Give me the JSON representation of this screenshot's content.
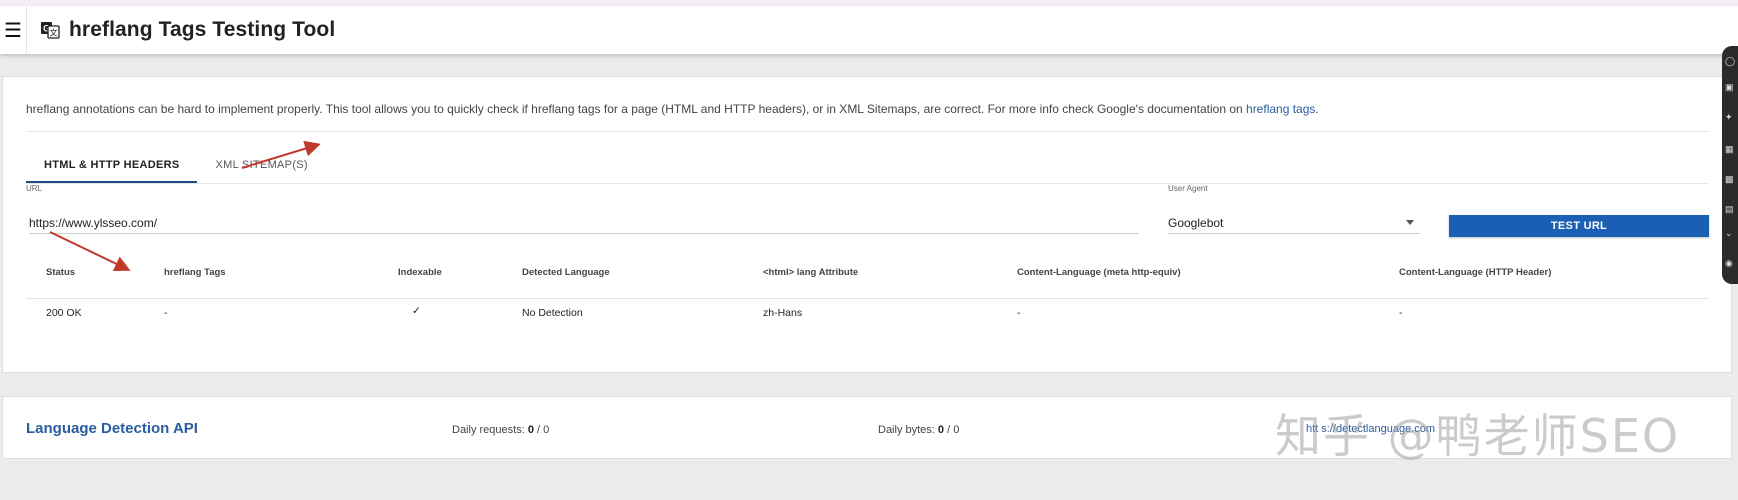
{
  "header": {
    "menu_icon": "hamburger-icon",
    "logo_icon": "translate-icon",
    "title": "hreflang Tags Testing Tool"
  },
  "intro": {
    "text": "hreflang annotations can be hard to implement properly. This tool allows you to quickly check if hreflang tags for a page (HTML and HTTP headers), or in XML Sitemaps, are correct. For more info check Google's documentation on ",
    "link": "hreflang tags",
    "end": "."
  },
  "tabs": [
    {
      "label": "HTML & HTTP HEADERS",
      "active": true
    },
    {
      "label": "XML SITEMAP(S)",
      "active": false
    }
  ],
  "form": {
    "url_label": "URL",
    "url_value": "https://www.ylsseo.com/",
    "ua_label": "User Agent",
    "ua_value": "Googlebot",
    "test_label": "TEST URL"
  },
  "results": {
    "headers": [
      "Status",
      "hreflang Tags",
      "Indexable",
      "Detected Language",
      "<html> lang Attribute",
      "Content-Language (meta http-equiv)",
      "Content-Language (HTTP Header)"
    ],
    "rows": [
      {
        "status": "200 OK",
        "hreflang": "-",
        "indexable": "✓",
        "detected": "No Detection",
        "html_lang": "zh-Hans",
        "meta_lang": "-",
        "http_lang": "-"
      }
    ]
  },
  "api": {
    "title": "Language Detection API",
    "requests_label": "Daily requests:",
    "requests_used": "0",
    "requests_sep": " / 0",
    "bytes_label": "Daily bytes:",
    "bytes_used": "0",
    "bytes_sep": " / 0",
    "link_text": "htt s://detectlanguage.com"
  },
  "watermark": "知乎 @鸭老师SEO",
  "colors": {
    "accent": "#1a5fb4",
    "link": "#2a5d9f",
    "arrow": "#c0392b",
    "check": "#6aa84f"
  }
}
